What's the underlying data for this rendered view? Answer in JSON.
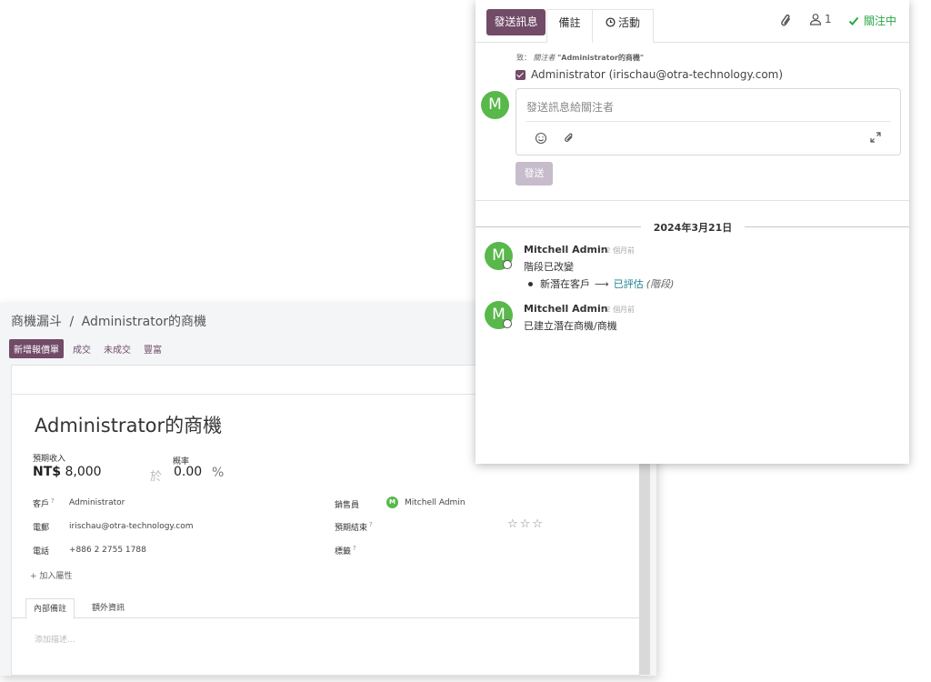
{
  "form": {
    "breadcrumb": {
      "parent": "商機漏斗",
      "separator": "/",
      "current": "Administrator的商機"
    },
    "actions": {
      "new_quotation": "新增報價單",
      "won": "成交",
      "lost": "未成交",
      "enrich": "豐富"
    },
    "name": "Administrator的商機",
    "expected_revenue_label": "預期收入",
    "probability_label": "概率",
    "currency": "NT$",
    "expected_revenue": "8,000",
    "at": "於",
    "probability": "0.00",
    "percent": "%",
    "customer_label": "客戶",
    "customer_value": "Administrator",
    "email_label": "電郵",
    "email_value": "irischau@otra-technology.com",
    "phone_label": "電話",
    "phone_value": "+886 2 2755 1788",
    "salesperson_label": "銷售員",
    "salesperson_avatar": "M",
    "salesperson_value": "Mitchell Admin",
    "expected_closing_label": "預期結束",
    "tags_label": "標籤",
    "help_mark": "?",
    "stars": "☆☆☆",
    "add_property": "+ 加入屬性",
    "tab_internal_notes": "內部備註",
    "tab_extra_info": "額外資訊",
    "description_placeholder": "添加描述..."
  },
  "chatter": {
    "send_message": "發送訊息",
    "log_note": "備註",
    "activities": "活動",
    "follower_count": "1",
    "following": "關注中",
    "to_prefix": "致：",
    "to_followers": "關注者",
    "to_record": "\"Administrator的商機\"",
    "recipient": "Administrator (irischau@otra-technology.com)",
    "composer_avatar": "M",
    "composer_placeholder": "發送訊息給關注者",
    "send": "發送",
    "date_separator": "2024年3月21日",
    "messages": [
      {
        "avatar": "M",
        "author": "Mitchell Admin",
        "time": "- 2 個月前",
        "body": "階段已改變",
        "tracking_old": "新潛在客戶",
        "tracking_arrow": "⟶",
        "tracking_new": "已評估",
        "tracking_field": "(階段)"
      },
      {
        "avatar": "M",
        "author": "Mitchell Admin",
        "time": "- 2 個月前",
        "body": "已建立潛在商機/商機"
      }
    ]
  },
  "colors": {
    "primary": "#714b67",
    "avatar_green": "#58b84a",
    "following_green": "#28a745",
    "send_disabled": "#c7bccb"
  }
}
